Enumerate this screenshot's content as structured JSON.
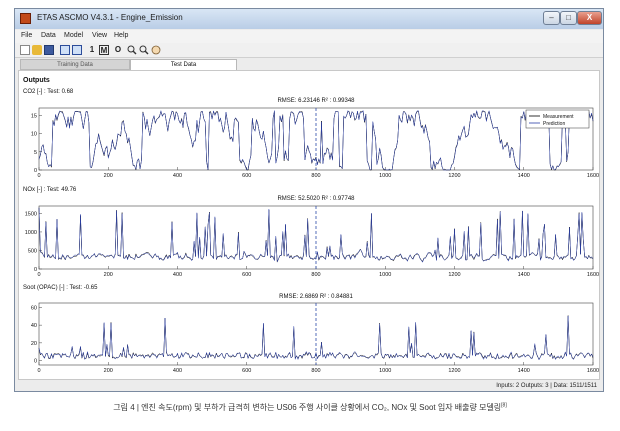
{
  "window": {
    "title": "ETAS ASCMO V4.3.1 - Engine_Emission",
    "min_label": "–",
    "max_label": "□",
    "close_label": "X"
  },
  "menu": [
    "File",
    "Data",
    "Model",
    "View",
    "Help"
  ],
  "toolbar": {
    "icons": [
      "new-icon",
      "open-icon",
      "save-icon",
      "import-icon",
      "export-icon",
      "one-d-icon",
      "model-icon",
      "optimize-icon",
      "zoom-in-icon",
      "zoom-out-icon",
      "pan-icon"
    ],
    "text_1": "1",
    "text_m": "M",
    "text_o": "O"
  },
  "tabs": {
    "training": "Training Data",
    "test": "Test Data"
  },
  "outputs_label": "Outputs",
  "colors": {
    "measurement": "#000000",
    "prediction": "#2b3fa8",
    "marker": "#2a4aa8"
  },
  "plots": [
    {
      "label": "CO2 [-] : Test: 0.68",
      "rmse": "RMSE: 6.23146   R² : 0.99348",
      "yticks": [
        "0",
        "5",
        "10",
        "15"
      ],
      "ymin": 0,
      "ymax": 17,
      "legend": [
        "Measurement",
        "Prediction"
      ]
    },
    {
      "label": "NOx [-] : Test: 49.76",
      "rmse": "RMSE: 52.5020   R² : 0.97748",
      "yticks": [
        "0",
        "500",
        "1000",
        "1500"
      ],
      "ymin": 0,
      "ymax": 1700
    },
    {
      "label": "Soot (OPAC) [-] : Test: -0.65",
      "rmse": "RMSE: 2.6869   R² : 0.84881",
      "yticks": [
        "0",
        "20",
        "40",
        "60"
      ],
      "ymin": -5,
      "ymax": 65
    }
  ],
  "xaxis": {
    "min": 0,
    "max": 1600,
    "ticks": [
      "0",
      "200",
      "400",
      "600",
      "800",
      "1000",
      "1200",
      "1400",
      "1600"
    ],
    "marker_at": 800
  },
  "status": "Inputs: 2 Outputs: 3 | Data: 1511/1511",
  "caption": "그림 4  |  엔진 속도(rpm) 및 부하가 급격히 변하는 US06 주행 사이클 상황에서 CO₂, NOx 및 Soot 입자 배출량 모델링",
  "caption_ref": "[8]"
}
